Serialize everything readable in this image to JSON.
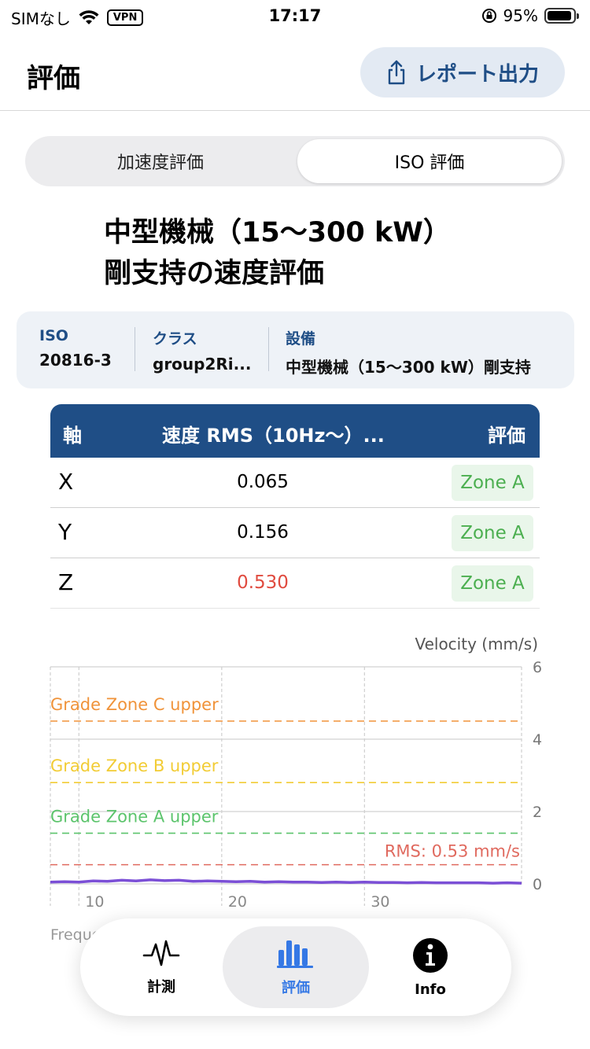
{
  "status": {
    "carrier": "SIMなし",
    "vpn": "VPN",
    "time": "17:17",
    "battery": "95%"
  },
  "nav": {
    "title": "評価",
    "report_label": "レポート出力"
  },
  "segment": {
    "options": [
      "加速度評価",
      "ISO 評価"
    ],
    "selected": "ISO 評価"
  },
  "heading": {
    "line1": "中型機械（15～300 kW）",
    "line2": "剛支持の速度評価"
  },
  "info": {
    "iso_label": "ISO",
    "iso_value": "20816-3",
    "class_label": "クラス",
    "class_value": "group2Ri...",
    "equipment_label": "設備",
    "equipment_value": "中型機械（15～300 kW）剛支持"
  },
  "table": {
    "headers": {
      "axis": "軸",
      "velocity": "速度 RMS（10Hz～）...",
      "evaluation": "評価"
    },
    "rows": [
      {
        "axis": "X",
        "value": "0.065",
        "zone": "Zone A"
      },
      {
        "axis": "Y",
        "value": "0.156",
        "zone": "Zone A"
      },
      {
        "axis": "Z",
        "value": "0.530",
        "zone": "Zone A"
      }
    ]
  },
  "chart_data": {
    "type": "line",
    "ylabel": "Velocity (mm/s)",
    "xlabel": "Frequency (Hz)",
    "xlim": [
      8,
      41
    ],
    "ylim": [
      0,
      6
    ],
    "x_ticks": [
      10,
      20,
      30
    ],
    "y_ticks": [
      0,
      2,
      4,
      6
    ],
    "grid": true,
    "thresholds": [
      {
        "name": "Grade Zone C upper",
        "value": 4.5,
        "color": "#f0933a"
      },
      {
        "name": "Grade Zone B upper",
        "value": 2.8,
        "color": "#f2cc35"
      },
      {
        "name": "Grade Zone A upper",
        "value": 1.4,
        "color": "#5cc46c"
      },
      {
        "name": "RMS: 0.53 mm/s",
        "value": 0.53,
        "color": "#e06a5f"
      }
    ],
    "series": [
      {
        "color": "#7b4fd6",
        "x": [
          8,
          9,
          10,
          11,
          12,
          13,
          14,
          15,
          16,
          17,
          18,
          19,
          20,
          21,
          22,
          23,
          24,
          25,
          26,
          27,
          28,
          29,
          30,
          31,
          32,
          33,
          34,
          35,
          36,
          37,
          38,
          39,
          40,
          41
        ],
        "y": [
          0.05,
          0.06,
          0.05,
          0.08,
          0.07,
          0.1,
          0.08,
          0.11,
          0.09,
          0.1,
          0.07,
          0.08,
          0.07,
          0.06,
          0.07,
          0.05,
          0.06,
          0.05,
          0.05,
          0.04,
          0.05,
          0.04,
          0.05,
          0.04,
          0.04,
          0.03,
          0.04,
          0.03,
          0.03,
          0.03,
          0.03,
          0.02,
          0.03,
          0.02
        ]
      }
    ]
  },
  "tabs": [
    {
      "label": "計測",
      "icon": "waveform-icon"
    },
    {
      "label": "評価",
      "icon": "bar-chart-icon"
    },
    {
      "label": "Info",
      "icon": "info-icon"
    }
  ]
}
